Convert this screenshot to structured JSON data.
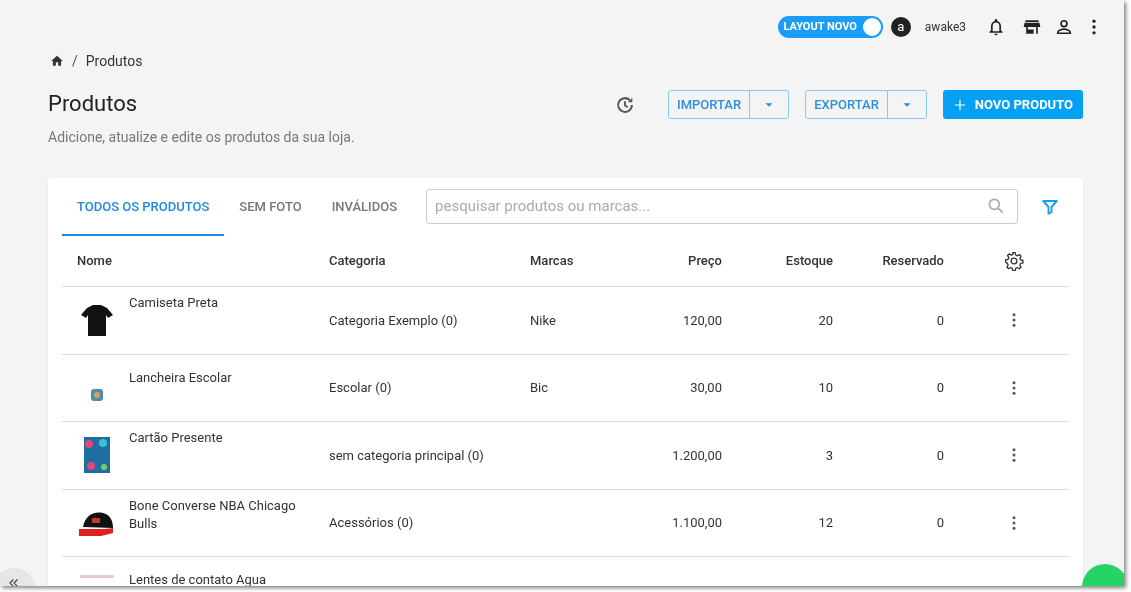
{
  "topbar": {
    "layout_toggle": {
      "label": "LAYOUT NOVO",
      "on": true
    },
    "avatar_letter": "a",
    "username": "awake3"
  },
  "breadcrumb": {
    "separator": "/",
    "current": "Produtos"
  },
  "header": {
    "title": "Produtos",
    "subtitle": "Adicione, atualize e edite os produtos da sua loja."
  },
  "actions": [
    {
      "kind": "split",
      "label": "IMPORTAR"
    },
    {
      "kind": "split",
      "label": "EXPORTAR"
    },
    {
      "kind": "primary",
      "label": "NOVO PRODUTO"
    }
  ],
  "tabs": [
    {
      "label": "TODOS OS PRODUTOS",
      "selected": true
    },
    {
      "label": "SEM FOTO",
      "selected": false
    },
    {
      "label": "INVÁLIDOS",
      "selected": false
    }
  ],
  "search": {
    "placeholder": "pesquisar produtos ou marcas..."
  },
  "table": {
    "columns": [
      "Nome",
      "Categoria",
      "Marcas",
      "Preço",
      "Estoque",
      "Reservado"
    ],
    "rows": [
      {
        "name": "Camiseta Preta",
        "category": "Categoria Exemplo (0)",
        "brand": "Nike",
        "price": "120,00",
        "stock": "20",
        "reserved": "0"
      },
      {
        "name": "Lancheira Escolar",
        "category": "Escolar (0)",
        "brand": "Bic",
        "price": "30,00",
        "stock": "10",
        "reserved": "0"
      },
      {
        "name": "Cartão Presente",
        "category": "sem categoria principal (0)",
        "price": "1.200,00",
        "stock": "3",
        "reserved": "0"
      },
      {
        "name": "Bone Converse NBA Chicago Bulls",
        "category": "Acessórios (0)",
        "price": "1.100,00",
        "stock": "12",
        "reserved": "0"
      },
      {
        "name": "Lentes de contato Agua"
      }
    ]
  }
}
